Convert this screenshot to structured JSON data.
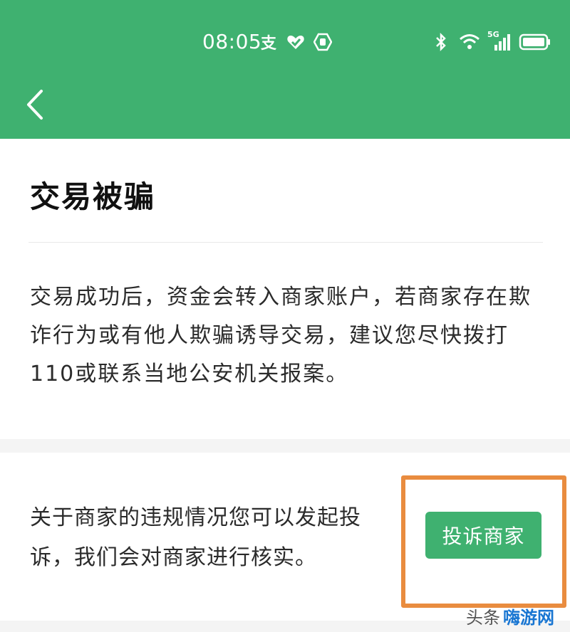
{
  "status_bar": {
    "time": "08:05",
    "left_icon_glyph": "支",
    "network_label": "5G"
  },
  "page": {
    "title": "交易被骗",
    "description": "交易成功后，资金会转入商家账户，若商家存在欺诈行为或有他人欺骗诱导交易，建议您尽快拨打110或联系当地公安机关报案。"
  },
  "complaint": {
    "text": "关于商家的违规情况您可以发起投诉，我们会对商家进行核实。",
    "button_label": "投诉商家"
  },
  "watermark": {
    "text": "头条",
    "logo_text": "嗨游网"
  },
  "colors": {
    "brand_green": "#3fb170",
    "highlight_orange": "#e98c3f"
  }
}
